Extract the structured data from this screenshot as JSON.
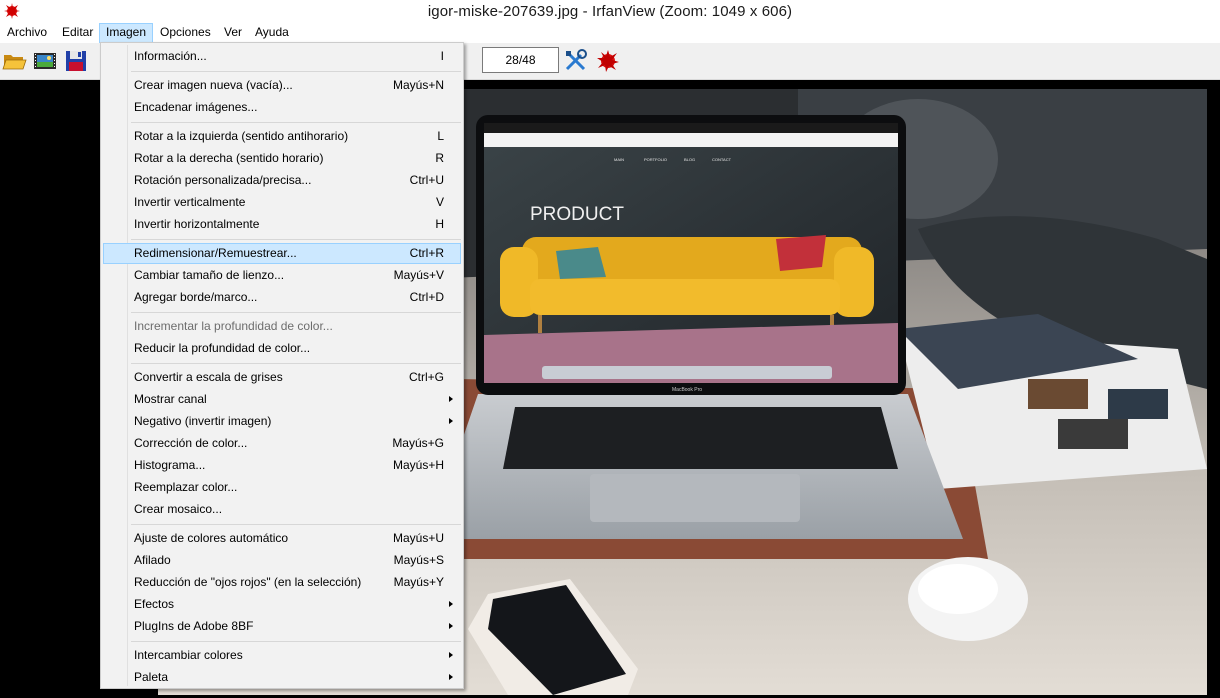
{
  "window": {
    "title": "igor-miske-207639.jpg - IrfanView (Zoom: 1049 x 606)"
  },
  "menubar": {
    "items": [
      "Archivo",
      "Editar",
      "Imagen",
      "Opciones",
      "Ver",
      "Ayuda"
    ],
    "active": "Imagen"
  },
  "toolbar": {
    "page_counter": "28/48",
    "icons": [
      "open-folder-icon",
      "slideshow-icon",
      "save-icon",
      "settings-tools-icon",
      "irfanview-logo-icon"
    ]
  },
  "image_menu": {
    "items": [
      {
        "label": "Información...",
        "shortcut": "I"
      },
      {
        "label": "Crear imagen nueva (vacía)...",
        "shortcut": "Mayús+N"
      },
      {
        "label": "Encadenar imágenes...",
        "shortcut": ""
      },
      {
        "label": "Rotar a la izquierda (sentido antihorario)",
        "shortcut": "L"
      },
      {
        "label": "Rotar a la derecha (sentido horario)",
        "shortcut": "R"
      },
      {
        "label": "Rotación personalizada/precisa...",
        "shortcut": "Ctrl+U"
      },
      {
        "label": "Invertir verticalmente",
        "shortcut": "V"
      },
      {
        "label": "Invertir horizontalmente",
        "shortcut": "H"
      },
      {
        "label": "Redimensionar/Remuestrear...",
        "shortcut": "Ctrl+R",
        "selected": true
      },
      {
        "label": "Cambiar tamaño de lienzo...",
        "shortcut": "Mayús+V"
      },
      {
        "label": "Agregar borde/marco...",
        "shortcut": "Ctrl+D"
      },
      {
        "label": "Incrementar la profundidad de color...",
        "shortcut": "",
        "disabled": true
      },
      {
        "label": "Reducir la profundidad de color...",
        "shortcut": ""
      },
      {
        "label": "Convertir a escala de grises",
        "shortcut": "Ctrl+G"
      },
      {
        "label": "Mostrar canal",
        "shortcut": "",
        "submenu": true
      },
      {
        "label": "Negativo (invertir imagen)",
        "shortcut": "",
        "submenu": true
      },
      {
        "label": "Corrección de color...",
        "shortcut": "Mayús+G"
      },
      {
        "label": "Histograma...",
        "shortcut": "Mayús+H"
      },
      {
        "label": "Reemplazar color...",
        "shortcut": ""
      },
      {
        "label": "Crear mosaico...",
        "shortcut": ""
      },
      {
        "label": "Ajuste de colores automático",
        "shortcut": "Mayús+U"
      },
      {
        "label": "Afilado",
        "shortcut": "Mayús+S"
      },
      {
        "label": "Reducción de \"ojos rojos\" (en la selección)",
        "shortcut": "Mayús+Y"
      },
      {
        "label": "Efectos",
        "shortcut": "",
        "submenu": true
      },
      {
        "label": "PlugIns de Adobe 8BF",
        "shortcut": "",
        "submenu": true
      },
      {
        "label": "Intercambiar colores",
        "shortcut": "",
        "submenu": true
      },
      {
        "label": "Paleta",
        "shortcut": "",
        "submenu": true
      }
    ]
  },
  "photo": {
    "screen_heading": "PRODUCT",
    "nav_items": [
      "MAIN",
      "PORTFOLIO",
      "BLOG",
      "CONTACT"
    ],
    "laptop_label": "MacBook Pro"
  },
  "colors": {
    "menu_highlight": "#cce8ff",
    "menu_highlight_border": "#99d1ff",
    "menu_bg": "#f2f2f2",
    "sofa": "#e8b020"
  }
}
